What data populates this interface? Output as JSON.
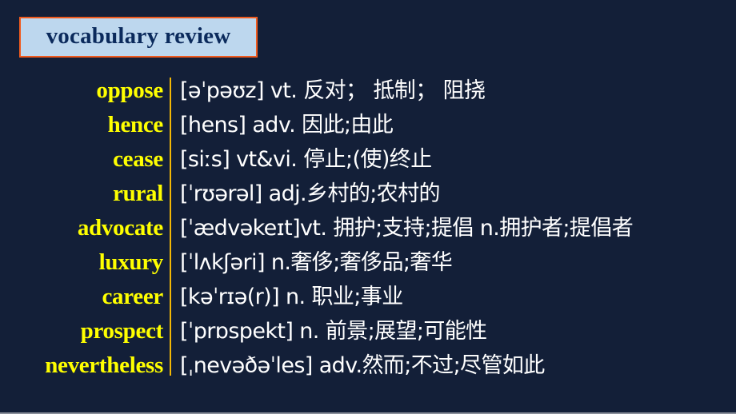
{
  "slide": {
    "title": "vocabulary review",
    "colors": {
      "background": "#131f38",
      "title_box_fill": "#bdd7ee",
      "title_box_border": "#f05a1e",
      "title_text": "#0b2a5c",
      "word_text": "#ffff00",
      "definition_text": "#ffffff",
      "divider": "#f2b705"
    },
    "entries": [
      {
        "word": "oppose",
        "definition": "[əˈpəʊz] vt. 反对； 抵制； 阻挠"
      },
      {
        "word": "hence",
        "definition": "[hens] adv. 因此;由此"
      },
      {
        "word": "cease",
        "definition": "[siːs] vt&vi. 停止;(使)终止"
      },
      {
        "word": "rural",
        "definition": "[ˈrʊərəl] adj.乡村的;农村的"
      },
      {
        "word": "advocate",
        "definition": "[ˈædvəkeɪt]vt. 拥护;支持;提倡 n.拥护者;提倡者"
      },
      {
        "word": "luxury",
        "definition": "[ˈlʌkʃəri] n.奢侈;奢侈品;奢华"
      },
      {
        "word": "career",
        "definition": "[kəˈrɪə(r)] n. 职业;事业"
      },
      {
        "word": "prospect",
        "definition": "[ˈprɒspekt] n.  前景;展望;可能性"
      },
      {
        "word": "nevertheless",
        "definition": "[ˌnevəðəˈles] adv.然而;不过;尽管如此"
      }
    ]
  }
}
